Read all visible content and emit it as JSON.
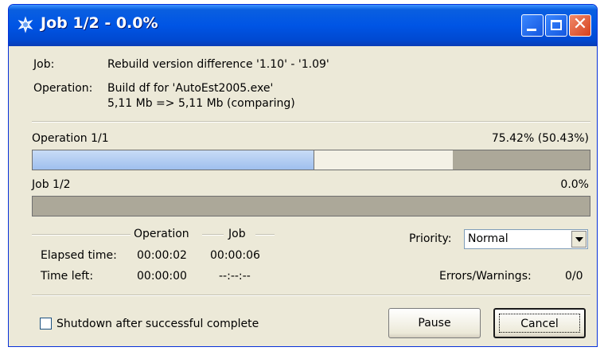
{
  "window": {
    "title": "Job 1/2 - 0.0%"
  },
  "info": {
    "job_label": "Job:",
    "job_value": "Rebuild version difference '1.10' - '1.09'",
    "operation_label": "Operation:",
    "operation_value": "Build df for 'AutoEst2005.exe'",
    "operation_detail": "5,11 Mb => 5,11 Mb (comparing)"
  },
  "operation_progress": {
    "label": "Operation 1/1",
    "percent_text": "75.42% (50.43%)",
    "primary_fraction": 0.5043,
    "secondary_fraction": 0.7542
  },
  "job_progress": {
    "label": "Job 1/2",
    "percent_text": "0.0%",
    "fraction": 0.0
  },
  "timing": {
    "col_operation": "Operation",
    "col_job": "Job",
    "elapsed_label": "Elapsed time:",
    "elapsed_operation": "00:00:02",
    "elapsed_job": "00:00:06",
    "left_label": "Time left:",
    "left_operation": "00:00:00",
    "left_job": "--:--:--"
  },
  "priority": {
    "label": "Priority:",
    "value": "Normal"
  },
  "errors": {
    "label": "Errors/Warnings:",
    "value": "0/0"
  },
  "shutdown_checkbox": {
    "label": "Shutdown after successful complete",
    "checked": false
  },
  "buttons": {
    "pause": "Pause",
    "cancel": "Cancel"
  },
  "colors": {
    "title_bar": "#0055e5",
    "progress_fill": "#9fbfee",
    "progress_secondary": "#f4f1e6",
    "progress_track": "#aca899"
  }
}
